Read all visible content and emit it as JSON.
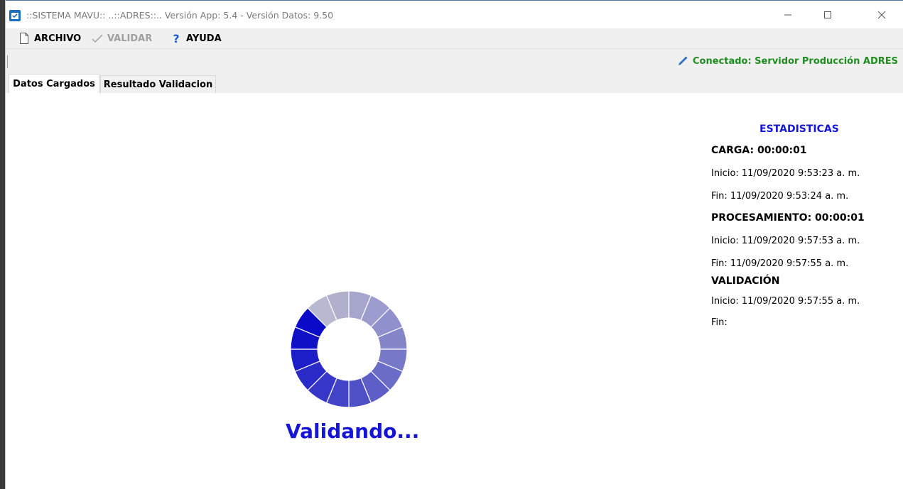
{
  "window": {
    "title": "::SISTEMA MAVU:: ..::ADRES::..  Versión App: 5.4  -  Versión Datos: 9.50"
  },
  "menu": {
    "archivo": "ARCHIVO",
    "validar": "VALIDAR",
    "ayuda": "AYUDA"
  },
  "status": {
    "connection": "Conectado: Servidor Producción ADRES",
    "connection_color": "#1f8c1f"
  },
  "tabs": [
    {
      "label": "Datos Cargados",
      "active": true
    },
    {
      "label": "Resultado Validacion",
      "active": false
    }
  ],
  "main": {
    "loading_text": "Validando...",
    "loading_color": "#1515d8"
  },
  "stats": {
    "title": "ESTADISTICAS",
    "carga": {
      "header": "CARGA: 00:00:01",
      "inicio": "Inicio: 11/09/2020 9:53:23 a. m.",
      "fin": "Fin: 11/09/2020 9:53:24 a. m."
    },
    "procesamiento": {
      "header": "PROCESAMIENTO: 00:00:01",
      "inicio": "Inicio: 11/09/2020 9:57:53 a. m.",
      "fin": "Fin: 11/09/2020 9:57:55 a. m."
    },
    "validacion": {
      "header": "VALIDACIÓN",
      "inicio": "Inicio: 11/09/2020 9:57:55 a. m.",
      "fin": "Fin:"
    }
  },
  "icons": {
    "app": "app-icon",
    "archivo": "file-icon",
    "validar": "check-icon",
    "ayuda": "question-icon",
    "connection": "pen-icon"
  }
}
